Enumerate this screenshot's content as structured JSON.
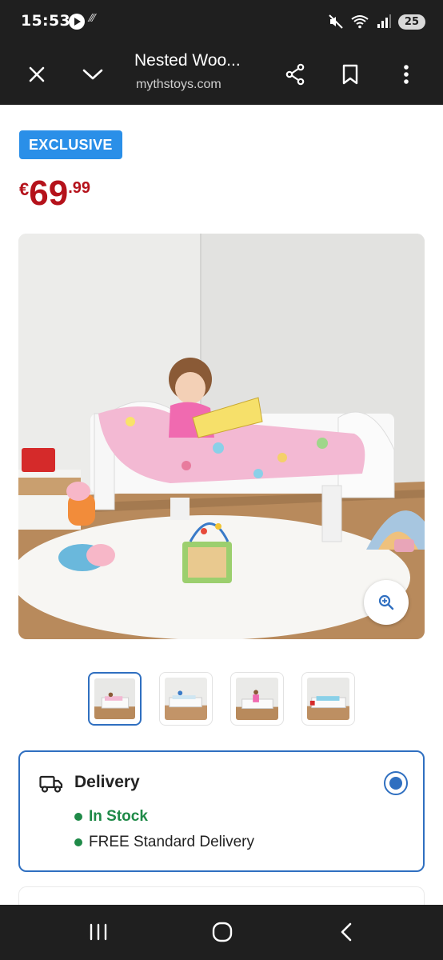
{
  "status_bar": {
    "time": "15:53",
    "misc": "⁄⁄⁄",
    "battery": "25"
  },
  "browser": {
    "title": "Nested Woo...",
    "domain": "mythstoys.com"
  },
  "product": {
    "badge": "EXCLUSIVE",
    "price": {
      "currency": "€",
      "main": "69",
      "cents": ".99"
    }
  },
  "gallery": {
    "thumbnail_count": 4,
    "active_index": 0
  },
  "delivery": {
    "title": "Delivery",
    "stock_status": "In Stock",
    "shipping": "FREE Standard Delivery",
    "selected": true
  },
  "colors": {
    "badge": "#2a8fe8",
    "price": "#b5121b",
    "accent": "#2f6fc0",
    "stock": "#1f8a48"
  }
}
